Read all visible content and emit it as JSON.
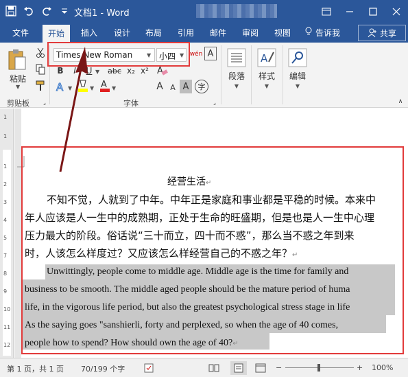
{
  "window": {
    "title": "文档1 - Word"
  },
  "tabs": [
    {
      "label": "文件"
    },
    {
      "label": "开始"
    },
    {
      "label": "插入"
    },
    {
      "label": "设计"
    },
    {
      "label": "布局"
    },
    {
      "label": "引用"
    },
    {
      "label": "邮件"
    },
    {
      "label": "审阅"
    },
    {
      "label": "视图"
    }
  ],
  "tellme": "告诉我",
  "share": "共享",
  "ribbon": {
    "paste": "粘贴",
    "clipboard_label": "剪贴板",
    "font_name": "Times New Roman",
    "font_size": "小四",
    "font_label": "字体",
    "paragraph": "段落",
    "styles": "样式",
    "editing": "编辑",
    "bold": "B",
    "italic": "I",
    "underline": "U",
    "strike": "abc",
    "subscript": "x₂",
    "superscript": "x²",
    "grow": "A",
    "shrink": "A",
    "clear": "A",
    "phonetic": "wén",
    "char_border": "A",
    "enclose": "字"
  },
  "colors": {
    "accent": "#2b579a",
    "highlight_red": "#e23b3b"
  },
  "document": {
    "heading": "经营生活",
    "cn_lines": [
      "不知不觉，人就到了中年。中年正是家庭和事业都是平稳的时候。本来中",
      "年人应该是人一生中的成熟期，正处于生命的旺盛期，但是也是人一生中心理",
      "压力最大的阶段。俗话说“三十而立，四十而不惑”，那么当不惑之年到来",
      "时，人该怎么样度过？又应该怎么样经营自己的不惑之年？"
    ],
    "en_lines": [
      "Unwittingly, people come to middle age. Middle age is the time for family and",
      "business to be smooth. The middle aged people should be the mature period of huma",
      "life, in the vigorous life period, but also the greatest psychological stress stage in life",
      "As the saying goes \"sanshierli, forty and perplexed, so when the age of 40 comes,",
      "people how to spend? How should own the age of 40?"
    ]
  },
  "statusbar": {
    "page": "第 1 页，共 1 页",
    "words": "70/199 个字",
    "zoom": "100%"
  }
}
